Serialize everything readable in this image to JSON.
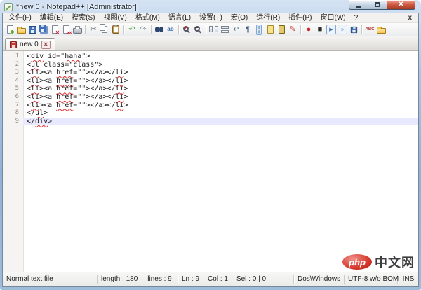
{
  "window": {
    "title": "*new 0 - Notepad++ [Administrator]"
  },
  "menu": {
    "items": [
      {
        "name": "menu-item-file",
        "label": "文件(F)"
      },
      {
        "name": "menu-item-edit",
        "label": "编辑(E)"
      },
      {
        "name": "menu-item-search",
        "label": "搜索(S)"
      },
      {
        "name": "menu-item-view",
        "label": "视图(V)"
      },
      {
        "name": "menu-item-format",
        "label": "格式(M)"
      },
      {
        "name": "menu-item-language",
        "label": "语言(L)"
      },
      {
        "name": "menu-item-settings",
        "label": "设置(T)"
      },
      {
        "name": "menu-item-macro",
        "label": "宏(O)"
      },
      {
        "name": "menu-item-run",
        "label": "运行(R)"
      },
      {
        "name": "menu-item-plugins",
        "label": "插件(P)"
      },
      {
        "name": "menu-item-window",
        "label": "窗口(W)"
      },
      {
        "name": "menu-item-help",
        "label": "?"
      }
    ],
    "close_glyph": "x"
  },
  "toolbar": {
    "icons": [
      {
        "n": "new-file-icon",
        "k": "k-page m-new"
      },
      {
        "n": "open-file-icon",
        "k": "k-folder"
      },
      {
        "n": "save-file-icon",
        "k": "k-floppy"
      },
      {
        "n": "save-all-icon",
        "k": "k-floppy m-all"
      },
      {
        "n": "close-file-icon",
        "k": "k-page m-close"
      },
      {
        "n": "close-all-icon",
        "k": "k-page m-closeall"
      },
      {
        "n": "print-icon",
        "k": "k-printer"
      },
      {
        "sep": 1
      },
      {
        "n": "cut-icon",
        "k": "k-glyph",
        "g": "✂",
        "c": "#5a6570"
      },
      {
        "n": "copy-icon",
        "k": "k-copy"
      },
      {
        "n": "paste-icon",
        "k": "k-clipboard"
      },
      {
        "sep": 1
      },
      {
        "n": "undo-icon",
        "k": "k-glyph",
        "g": "↶",
        "c": "#3f9d2f"
      },
      {
        "n": "redo-icon",
        "k": "k-glyph",
        "g": "↷",
        "c": "#8797a8"
      },
      {
        "sep": 1
      },
      {
        "n": "find-icon",
        "k": "k-binoc"
      },
      {
        "n": "replace-icon",
        "k": "k-glyph m-small",
        "g": "ab",
        "c": "#2b5fae"
      },
      {
        "sep": 1
      },
      {
        "n": "zoom-in-icon",
        "k": "k-zoom m-in"
      },
      {
        "n": "zoom-out-icon",
        "k": "k-zoom m-out"
      },
      {
        "sep": 1
      },
      {
        "n": "sync-vertical-scroll-icon",
        "k": "k-winpair"
      },
      {
        "n": "sync-horizontal-scroll-icon",
        "k": "k-winpair m-h"
      },
      {
        "n": "word-wrap-icon",
        "k": "k-glyph",
        "g": "↵",
        "c": "#44628a"
      },
      {
        "n": "show-all-characters-icon",
        "k": "k-glyph",
        "g": "¶",
        "c": "#44628a"
      },
      {
        "n": "indent-guide-icon",
        "k": "k-glyph m-pressed",
        "g": "¦",
        "c": "#44628a"
      },
      {
        "n": "user-defined-language-icon",
        "k": "k-page m-yellow"
      },
      {
        "n": "function-list-icon",
        "k": "k-page m-dark"
      },
      {
        "n": "edit-pen-icon",
        "k": "k-glyph",
        "g": "✎",
        "c": "#c2332b"
      },
      {
        "sep": 1
      },
      {
        "n": "macro-record-icon",
        "k": "k-glyph",
        "g": "●",
        "c": "#cc2626"
      },
      {
        "n": "macro-stop-icon",
        "k": "k-glyph",
        "g": "■",
        "c": "#2b2b2b"
      },
      {
        "n": "macro-play-icon",
        "k": "k-glyph m-box",
        "g": "▶",
        "c": "#3566b0"
      },
      {
        "n": "macro-run-multiple-icon",
        "k": "k-glyph m-box",
        "g": "»",
        "c": "#3566b0"
      },
      {
        "n": "macro-save-icon",
        "k": "k-floppy m-mini"
      },
      {
        "sep": 1
      },
      {
        "n": "spell-check-icon",
        "k": "k-glyph m-abc",
        "g": "ABC",
        "c": "#b03030"
      },
      {
        "n": "doc-map-icon",
        "k": "k-folder"
      }
    ]
  },
  "tabs": [
    {
      "label": "new 0",
      "modified": true
    }
  ],
  "editor": {
    "current_line": 9,
    "lines": [
      {
        "num": "1",
        "segs": [
          [
            "<",
            0
          ],
          [
            "div",
            1
          ],
          [
            " id=\"",
            0
          ],
          [
            "haha",
            1
          ],
          [
            "\">",
            0
          ]
        ]
      },
      {
        "num": "2",
        "segs": [
          [
            "<",
            0
          ],
          [
            "ul",
            1
          ],
          [
            " class=\"class\">",
            0
          ]
        ]
      },
      {
        "num": "3",
        "segs": [
          [
            "<",
            0
          ],
          [
            "li",
            1
          ],
          [
            "><a ",
            0
          ],
          [
            "href",
            1
          ],
          [
            "=\"\"></a></",
            0
          ],
          [
            "li",
            1
          ],
          [
            ">",
            0
          ]
        ]
      },
      {
        "num": "4",
        "segs": [
          [
            "<",
            0
          ],
          [
            "li",
            1
          ],
          [
            "><a ",
            0
          ],
          [
            "href",
            1
          ],
          [
            "=\"\"></a></",
            0
          ],
          [
            "li",
            1
          ],
          [
            ">",
            0
          ]
        ]
      },
      {
        "num": "5",
        "segs": [
          [
            "<",
            0
          ],
          [
            "li",
            1
          ],
          [
            "><a ",
            0
          ],
          [
            "href",
            1
          ],
          [
            "=\"\"></a></",
            0
          ],
          [
            "li",
            1
          ],
          [
            ">",
            0
          ]
        ]
      },
      {
        "num": "6",
        "segs": [
          [
            "<",
            0
          ],
          [
            "li",
            1
          ],
          [
            "><a ",
            0
          ],
          [
            "href",
            1
          ],
          [
            "=\"\"></a></",
            0
          ],
          [
            "li",
            1
          ],
          [
            ">",
            0
          ]
        ]
      },
      {
        "num": "7",
        "segs": [
          [
            "<",
            0
          ],
          [
            "li",
            1
          ],
          [
            "><a ",
            0
          ],
          [
            "href",
            1
          ],
          [
            "=\"\"></a></",
            0
          ],
          [
            "li",
            1
          ],
          [
            ">",
            0
          ]
        ]
      },
      {
        "num": "8",
        "segs": [
          [
            "</",
            0
          ],
          [
            "ul",
            1
          ],
          [
            ">",
            0
          ]
        ]
      },
      {
        "num": "9",
        "segs": [
          [
            "</",
            0
          ],
          [
            "div",
            1
          ],
          [
            ">",
            0
          ]
        ]
      }
    ]
  },
  "watermark": {
    "logo_text": "php",
    "site_text": "中文网"
  },
  "status_bar": {
    "doc_type": "Normal text file",
    "length_label": "length : 180",
    "lines_label": "lines : 9",
    "ln_label": "Ln : 9",
    "col_label": "Col : 1",
    "sel_label": "Sel : 0 | 0",
    "eol": "Dos\\Windows",
    "encoding": "UTF-8 w/o BOM",
    "insert_mode": "INS"
  }
}
